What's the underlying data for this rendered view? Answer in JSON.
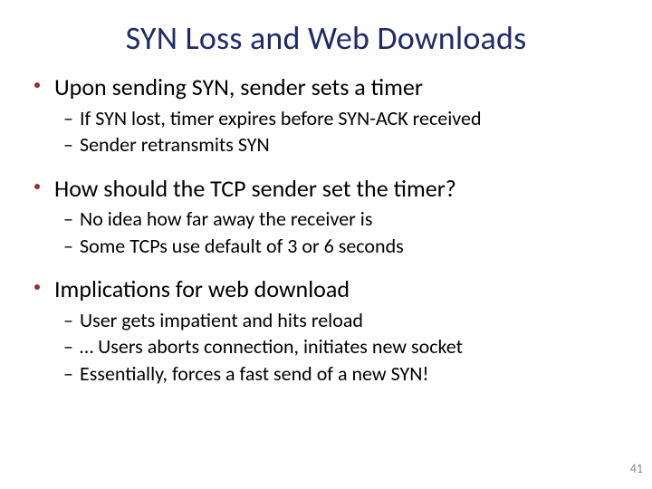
{
  "colors": {
    "title": "#1f2a6b",
    "accent": "#9b2d2d",
    "body": "#000000",
    "pagenum": "#8a8a8a"
  },
  "title": "SYN Loss and Web Downloads",
  "bullets": [
    {
      "text": "Upon sending SYN, sender sets a timer",
      "sub": [
        "If SYN lost, timer expires before SYN-ACK received",
        "Sender retransmits SYN"
      ]
    },
    {
      "text": "How should the TCP sender set the timer?",
      "sub": [
        "No idea how far away the receiver is",
        "Some TCPs use default of 3 or 6 seconds"
      ]
    },
    {
      "text": "Implications for web download",
      "sub": [
        "User gets impatient and hits reload",
        " … Users aborts connection, initiates new socket",
        "Essentially, forces a fast send of a new SYN!"
      ]
    }
  ],
  "page_number": "41"
}
